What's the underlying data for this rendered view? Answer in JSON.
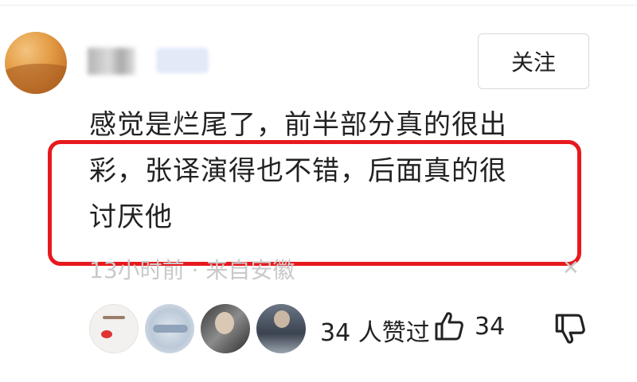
{
  "header": {
    "follow_label": "关注"
  },
  "comment": {
    "lines": [
      "感觉是烂尾了，前半部分真的很出",
      "彩，张译演得也不错，后面真的很",
      "讨厌他"
    ],
    "meta": "13小时前 · 来自安徽"
  },
  "footer": {
    "liked_by_text": "34 人赞过",
    "like_count": "34"
  },
  "colors": {
    "highlight": "#e8191e",
    "meta_text": "#c9c9c9"
  },
  "icons": {
    "like": "thumbs-up-icon",
    "dislike": "thumbs-down-icon",
    "close": "close-icon"
  }
}
